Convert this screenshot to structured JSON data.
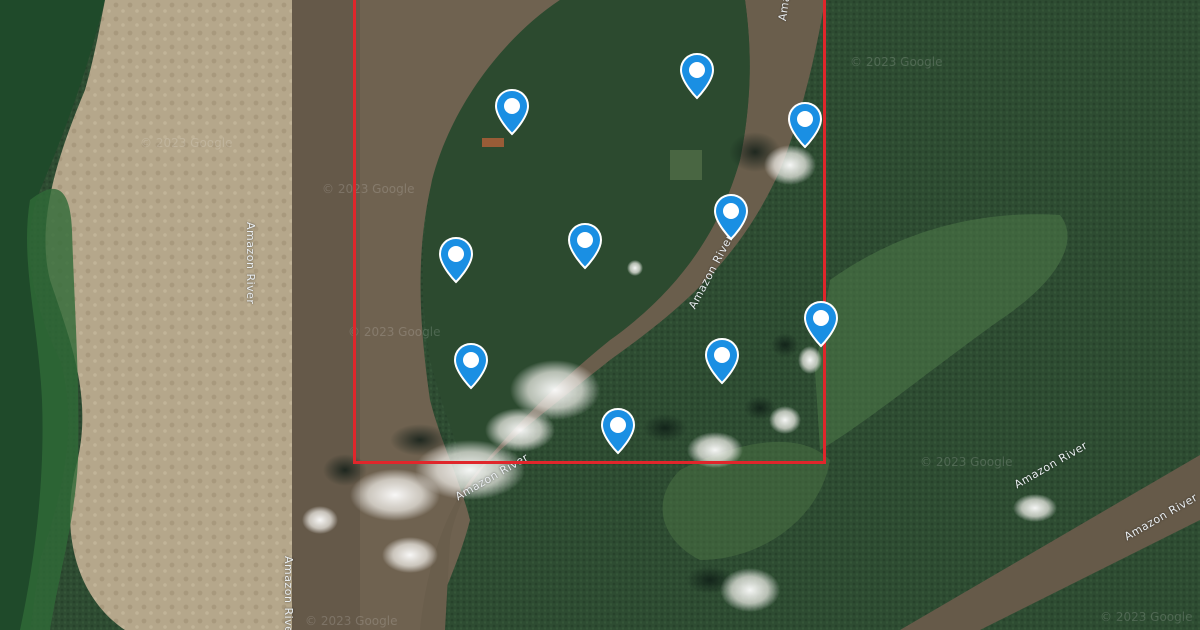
{
  "map": {
    "type": "satellite",
    "feature_label": "Amazon River",
    "labels": [
      {
        "id": "label-1",
        "text": "Amazon River"
      },
      {
        "id": "label-2",
        "text": "Amazon River"
      },
      {
        "id": "label-3",
        "text": "Amazon River"
      },
      {
        "id": "label-4",
        "text": "Amazon River"
      },
      {
        "id": "label-5",
        "text": "Amazon River"
      },
      {
        "id": "label-6",
        "text": "Amazon River"
      },
      {
        "id": "label-7",
        "text": "Amazon River"
      }
    ],
    "watermark": "© 2023 Google",
    "selection_color": "#e0262b",
    "pin_color": "#1a8fe3",
    "pin_count": 10
  }
}
